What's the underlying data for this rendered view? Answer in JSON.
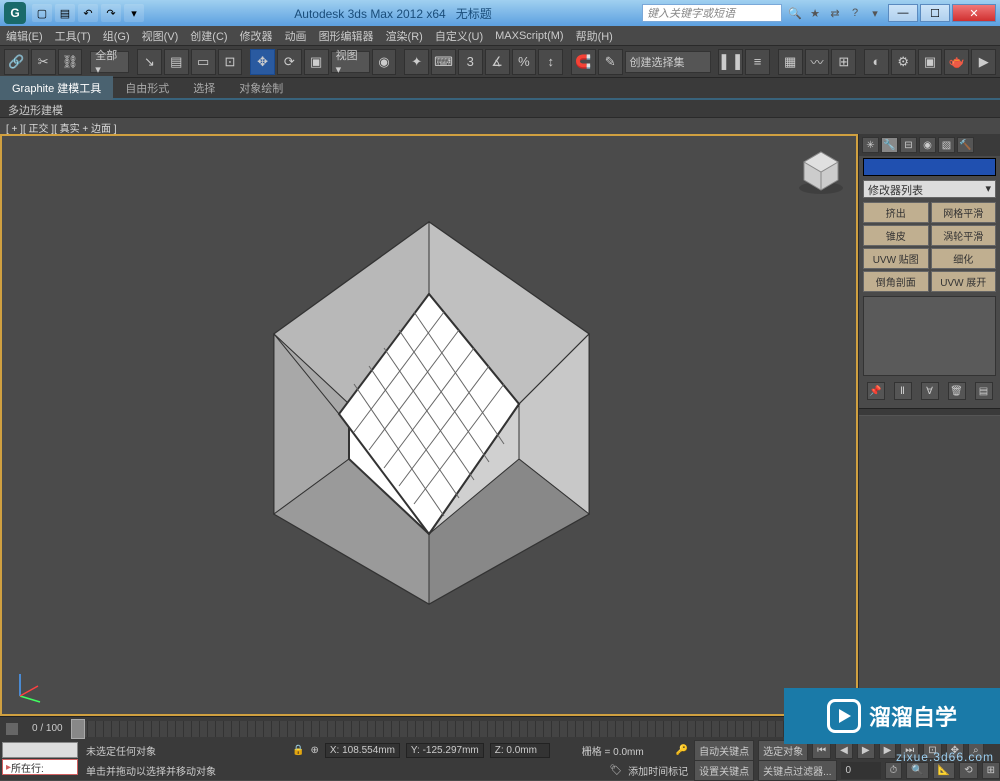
{
  "titlebar": {
    "app_title": "Autodesk 3ds Max  2012  x64",
    "doc_title": "无标题",
    "search_placeholder": "键入关键字或短语",
    "min": "—",
    "max": "☐",
    "close": "✕"
  },
  "menu": {
    "items": [
      "编辑(E)",
      "工具(T)",
      "组(G)",
      "视图(V)",
      "创建(C)",
      "修改器",
      "动画",
      "图形编辑器",
      "渲染(R)",
      "自定义(U)",
      "MAXScript(M)",
      "帮助(H)"
    ]
  },
  "toolbar": {
    "all_label": "全部 ▾",
    "view_label": "视图 ▾",
    "selset_label": "创建选择集"
  },
  "ribbon": {
    "tabs": [
      "Graphite 建模工具",
      "自由形式",
      "选择",
      "对象绘制"
    ],
    "sub": "多边形建模"
  },
  "viewport": {
    "label": "[ + ][ 正交 ][ 真实 + 边面 ]"
  },
  "sidepanel": {
    "modlist": "修改器列表",
    "buttons": [
      "挤出",
      "网格平滑",
      "锥皮",
      "涡轮平滑",
      "UVW 贴图",
      "细化",
      "倒角剖面",
      "UVW 展开"
    ]
  },
  "timeline": {
    "frame": "0 / 100"
  },
  "status": {
    "prompt_label": "所在行:",
    "no_select": "未选定任何对象",
    "hint": "单击并拖动以选择并移动对象",
    "x": "X: 108.554mm",
    "y": "Y: -125.297mm",
    "z": "Z: 0.0mm",
    "grid": "栅格 = 0.0mm",
    "addtime": "添加时间标记",
    "autokey": "自动关键点",
    "setkey": "设置关键点",
    "selfilter": "选定对象",
    "keyfilter": "关键点过滤器..."
  },
  "watermark": {
    "text": "溜溜自学",
    "url": "zixue.3d66.com"
  }
}
